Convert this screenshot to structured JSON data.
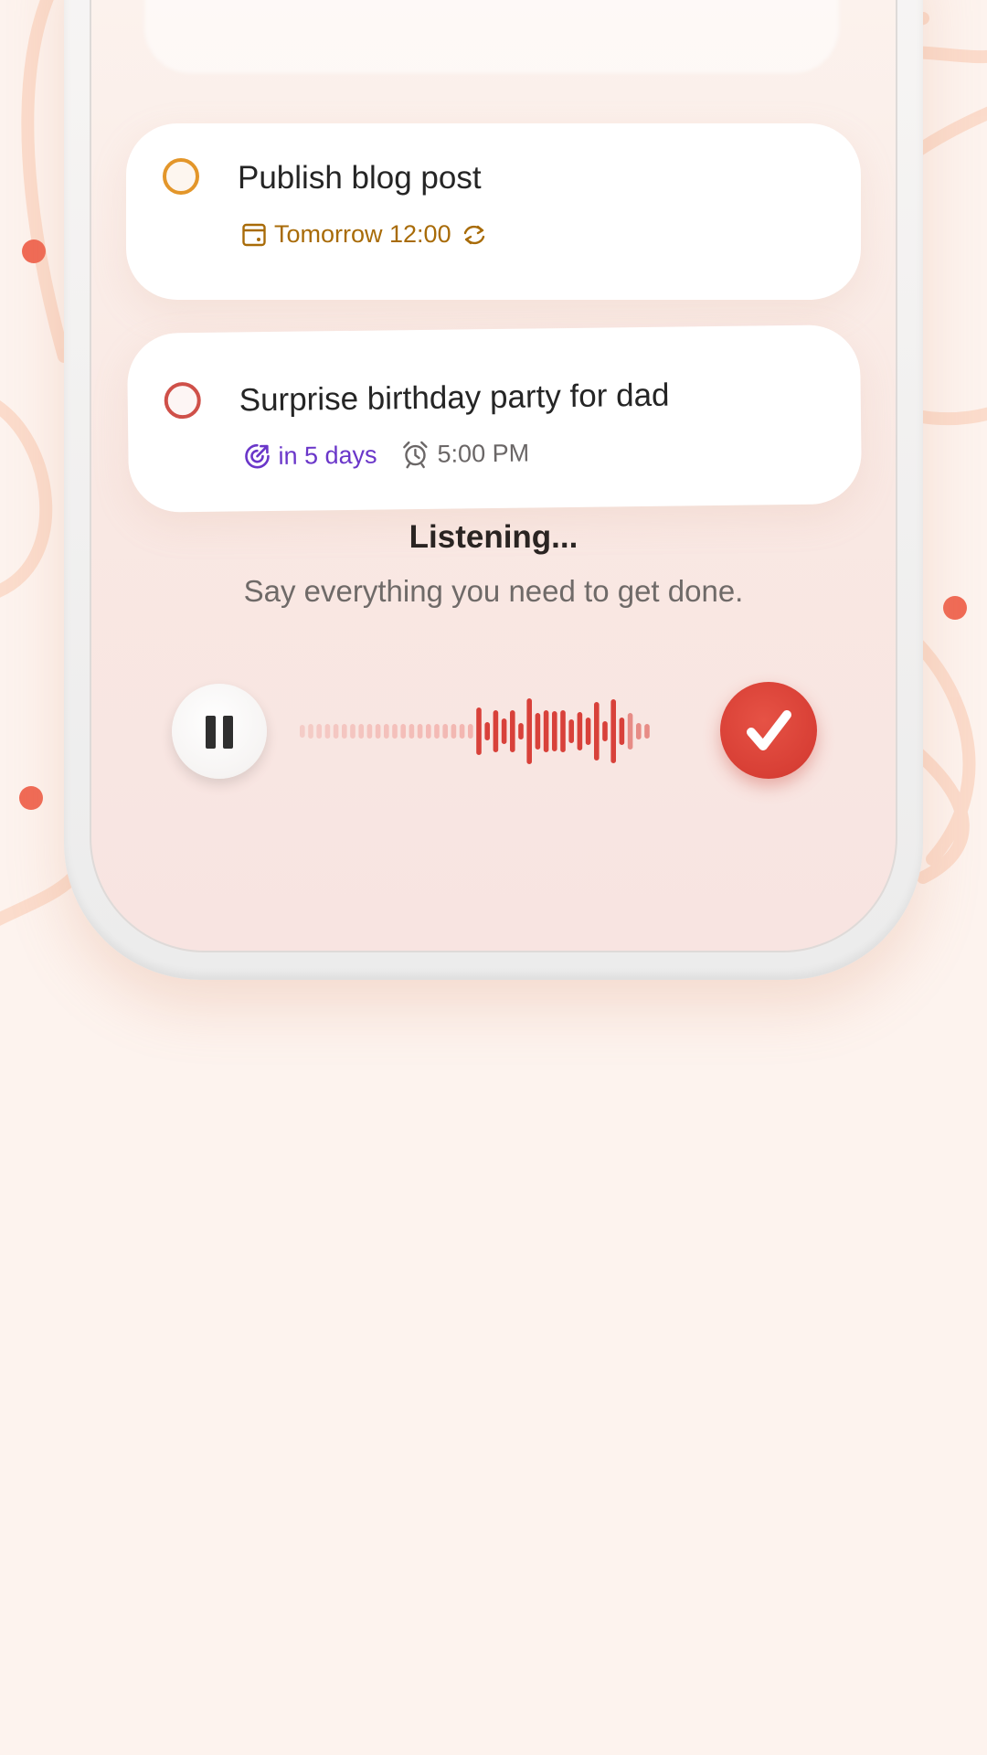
{
  "tasks": [
    {
      "title": "Publish blog post",
      "due": "Tomorrow 12:00",
      "due_color": "#a86b08",
      "priority_color": "#e3962a",
      "due_icon": "calendar-icon",
      "recurring_icon": "repeat-icon"
    },
    {
      "title": "Surprise birthday party for dad",
      "due": "in 5 days",
      "due_color": "#6a36c9",
      "priority_color": "#cf5049",
      "due_icon": "upcoming-icon",
      "reminder": "5:00 PM",
      "reminder_icon": "alarm-icon"
    }
  ],
  "voice": {
    "status": "Listening...",
    "prompt": "Say everything you need to get done.",
    "pause_icon": "pause-icon",
    "done_icon": "checkmark-icon",
    "accent": "#d83f35"
  }
}
